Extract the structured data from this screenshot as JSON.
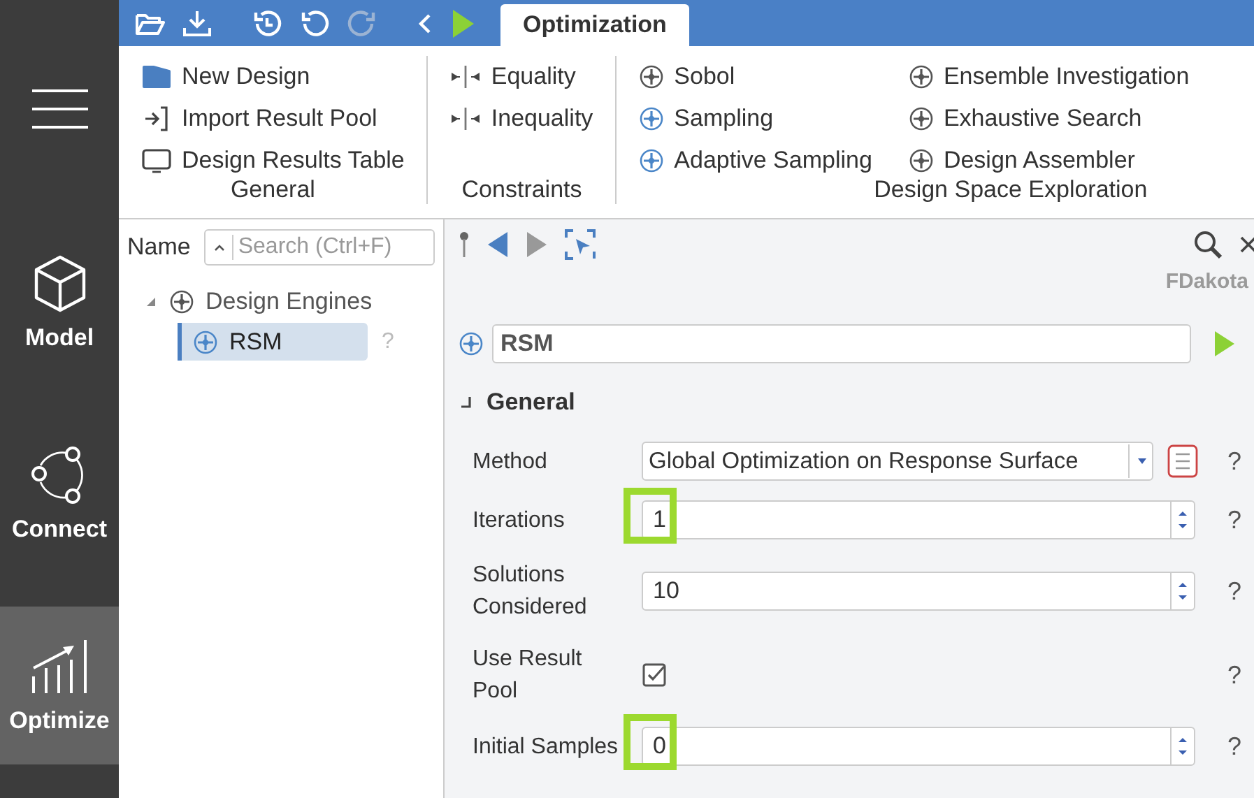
{
  "nav": [
    {
      "label": "Model",
      "kind": "model",
      "selected": false
    },
    {
      "label": "Connect",
      "kind": "connect",
      "selected": false
    },
    {
      "label": "Optimize",
      "kind": "optimize",
      "selected": true
    }
  ],
  "tabs": [
    {
      "label": "Optimization",
      "selected": true
    }
  ],
  "ribbon": {
    "groups": [
      {
        "title": "General",
        "columns": [
          [
            {
              "label": "New Design",
              "kind": "folder"
            },
            {
              "label": "Import Result Pool",
              "kind": "import"
            },
            {
              "label": "Design Results Table",
              "kind": "table"
            }
          ]
        ]
      },
      {
        "title": "Constraints",
        "columns": [
          [
            {
              "label": "Equality",
              "kind": "constraint"
            },
            {
              "label": "Inequality",
              "kind": "constraint"
            }
          ]
        ]
      },
      {
        "title": "Design Space Exploration",
        "columns": [
          [
            {
              "label": "Sobol",
              "kind": "engine",
              "color": "#555555"
            },
            {
              "label": "Sampling",
              "kind": "engine",
              "color": "#4a86c8"
            },
            {
              "label": "Adaptive Sampling",
              "kind": "engine",
              "color": "#4a86c8"
            }
          ],
          [
            {
              "label": "Ensemble Investigation",
              "kind": "engine",
              "color": "#555555"
            },
            {
              "label": "Exhaustive Search",
              "kind": "engine",
              "color": "#555555"
            },
            {
              "label": "Design Assembler",
              "kind": "engine",
              "color": "#555555"
            }
          ]
        ]
      }
    ]
  },
  "tree": {
    "header": "Name",
    "search": {
      "placeholder": "Search (Ctrl+F)"
    },
    "items": [
      {
        "label": "Design Engines",
        "color": "#555555",
        "expanded": true,
        "selected": false,
        "children": [
          {
            "label": "RSM",
            "color": "#4a86c8",
            "selected": true,
            "help": "?"
          }
        ]
      }
    ]
  },
  "editor": {
    "engine_label": "FDakota",
    "name": "RSM",
    "section": {
      "title": "General",
      "expanded": true
    },
    "rows": [
      {
        "kind": "select",
        "label": "Method",
        "value": "Global Optimization on Response Surface",
        "help": "?",
        "highlighted": false
      },
      {
        "kind": "spin",
        "label": "Iterations",
        "value": "1",
        "help": "?",
        "highlighted": true
      },
      {
        "kind": "spin",
        "label": "Solutions Considered",
        "value": "10",
        "help": "?",
        "highlighted": false
      },
      {
        "kind": "checkbox",
        "label": "Use Result Pool",
        "checked": true,
        "help": "?",
        "highlighted": false
      },
      {
        "kind": "spin",
        "label": "Initial Samples",
        "value": "0",
        "help": "?",
        "highlighted": true
      }
    ]
  }
}
